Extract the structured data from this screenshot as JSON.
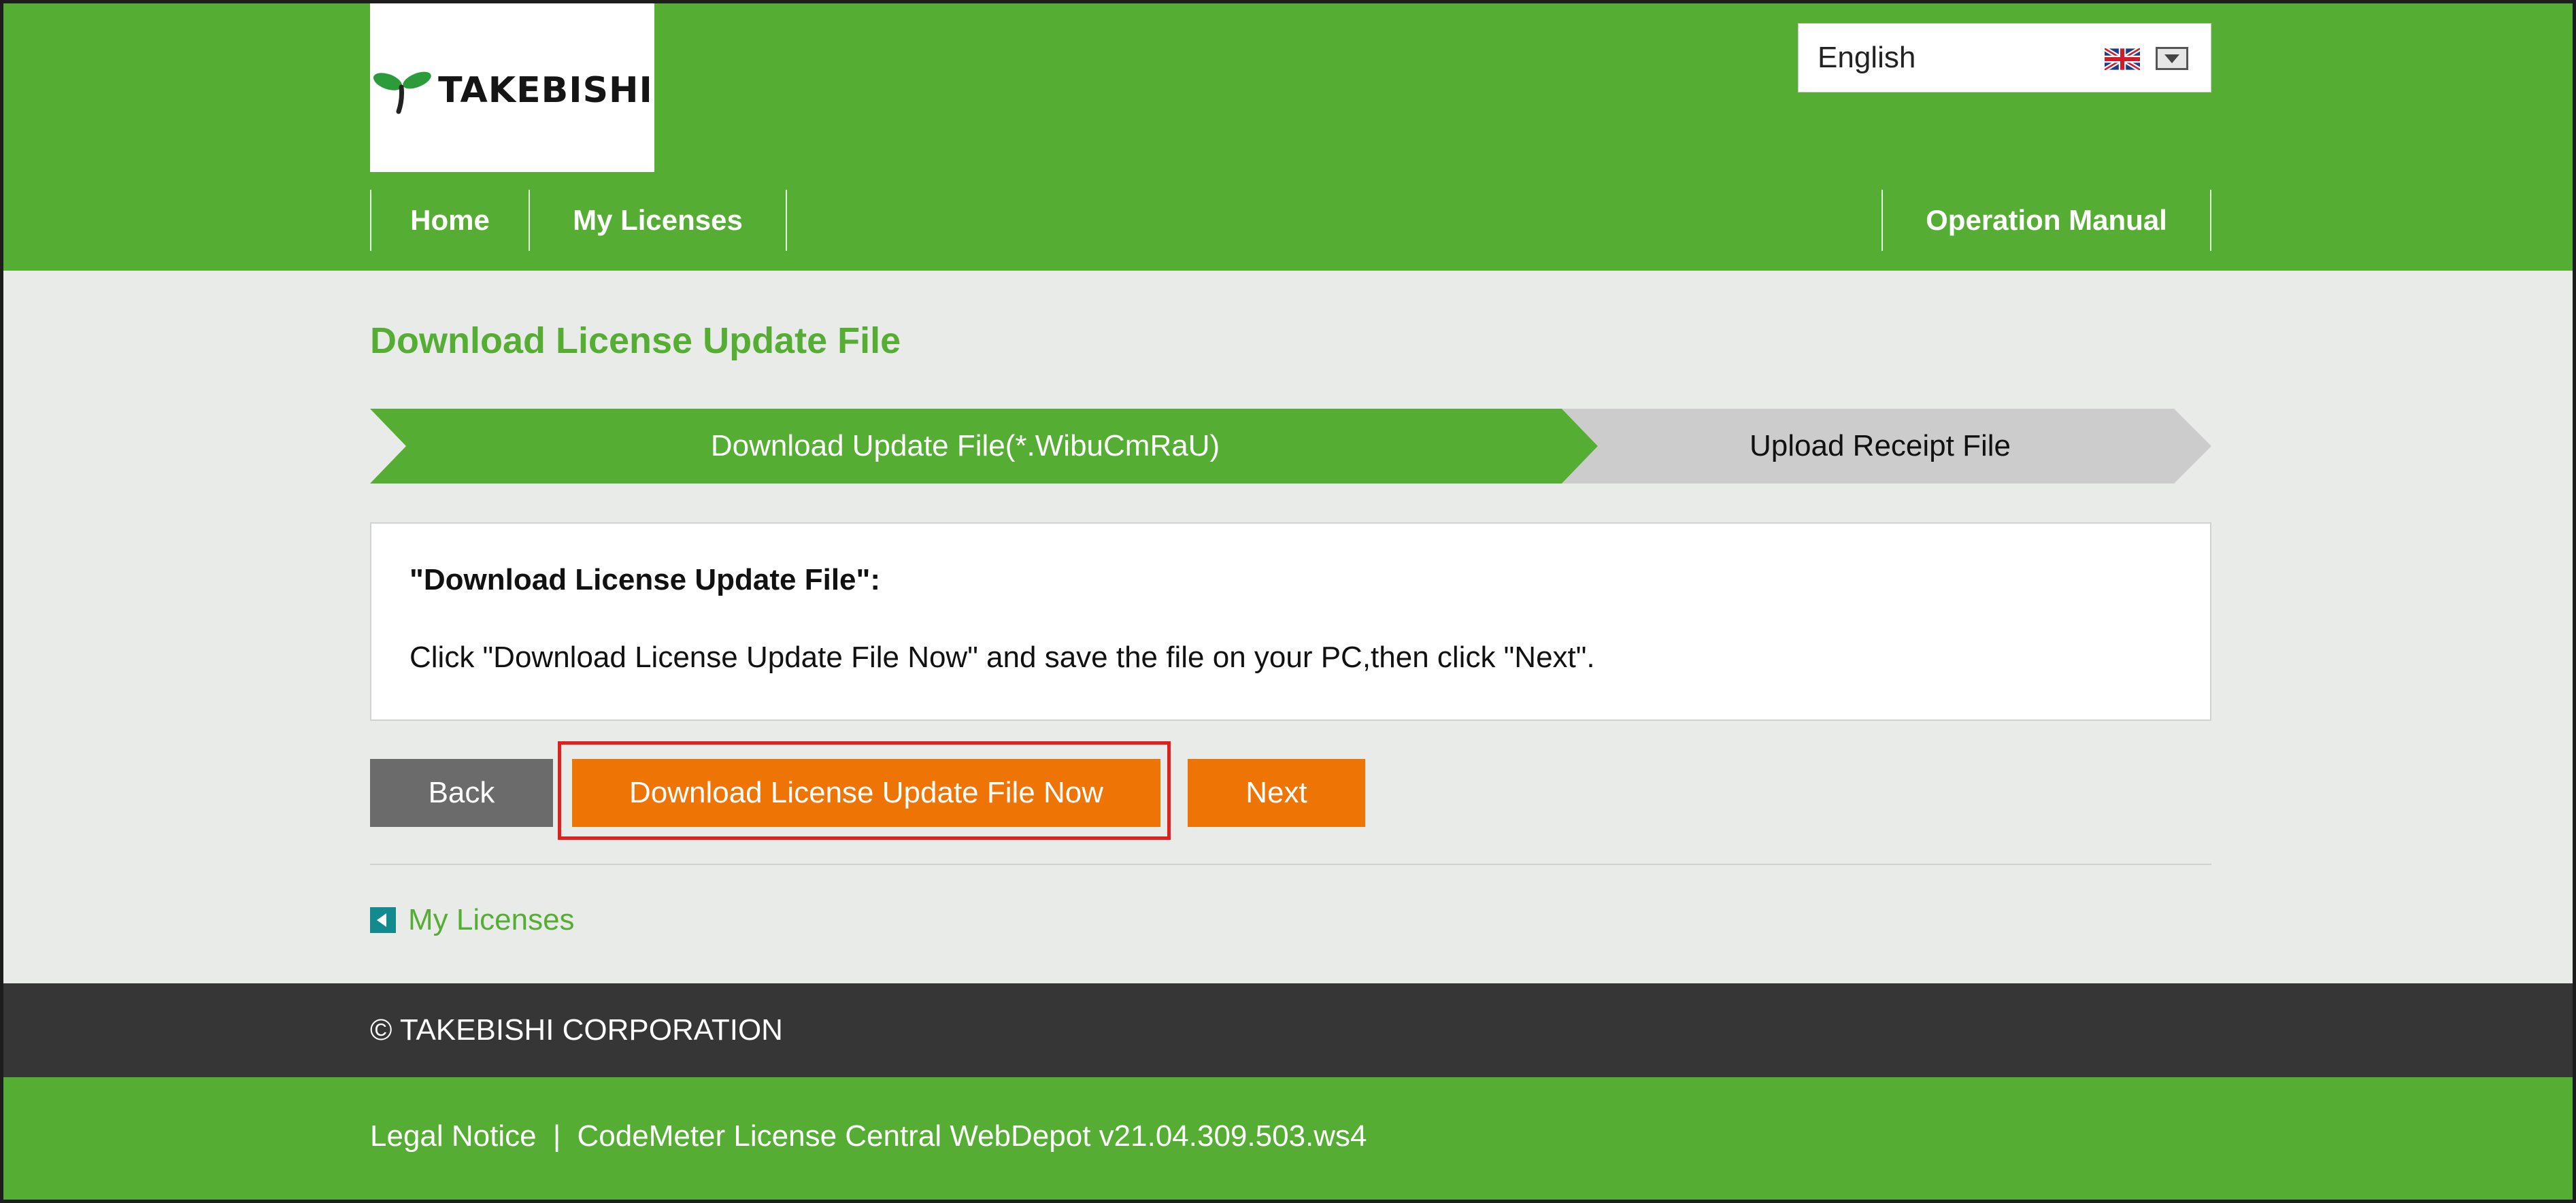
{
  "header": {
    "logo_text": "TAKEBISHI",
    "language": {
      "selected": "English",
      "flag_icon": "uk-flag-icon",
      "dropdown_icon": "dropdown-arrow-icon"
    },
    "nav_left": [
      {
        "label": "Home"
      },
      {
        "label": "My Licenses"
      }
    ],
    "nav_right": [
      {
        "label": "Operation Manual"
      }
    ]
  },
  "main": {
    "page_title": "Download License Update File",
    "steps": [
      {
        "label": "Download Update File(*.WibuCmRaU)",
        "active": true
      },
      {
        "label": "Upload Receipt File",
        "active": false
      }
    ],
    "info": {
      "title": "\"Download License Update File\":",
      "text": "Click \"Download License Update File Now\" and save the file on your PC,then click \"Next\"."
    },
    "buttons": {
      "back": "Back",
      "download": "Download License Update File Now",
      "next": "Next"
    },
    "back_link": {
      "icon": "caret-left-icon",
      "label": "My Licenses"
    }
  },
  "footer": {
    "copyright": "© TAKEBISHI CORPORATION",
    "legal_notice": "Legal Notice",
    "separator": "|",
    "product": "CodeMeter License Central WebDepot v21.04.309.503.ws4"
  },
  "colors": {
    "brand_green": "#55ae33",
    "accent_orange": "#ee7405",
    "step_inactive": "#cccccc",
    "footer_dark": "#363636",
    "highlight_red": "#e01f1f"
  }
}
